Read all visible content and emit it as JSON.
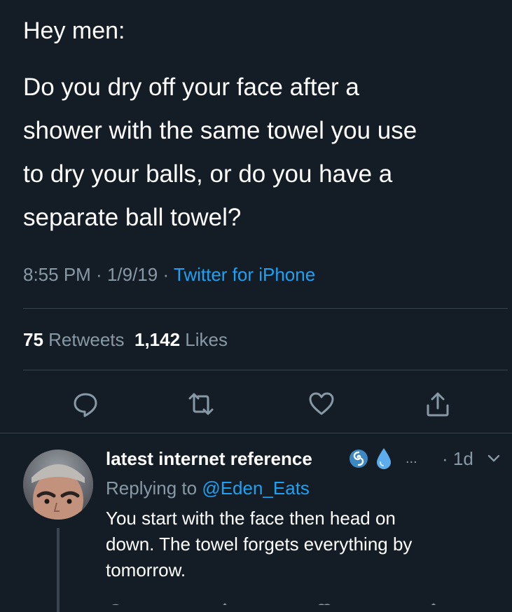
{
  "tweet": {
    "greeting": "Hey men:",
    "body_lines": [
      "Do you dry off your face after a",
      "shower with the same towel you use",
      "to dry your balls, or do you have a",
      "separate ball towel?"
    ],
    "time": "8:55 PM",
    "sep1": " · ",
    "date": "1/9/19",
    "sep2": " · ",
    "source": "Twitter for iPhone",
    "retweets_count": "75",
    "retweets_label": " Retweets",
    "likes_count": "1,142",
    "likes_label": " Likes",
    "accent_color": "#1da1f2",
    "background_color": "#141d26",
    "muted_color": "#8899a6"
  },
  "actions": {
    "icons": [
      "reply-icon",
      "retweet-icon",
      "like-icon",
      "share-icon"
    ]
  },
  "reply": {
    "name": "latest internet reference",
    "emojis": [
      "cyclone-emoji",
      "droplet-emoji"
    ],
    "ellipsis": "...",
    "time": "· 1d",
    "replying_prefix": "Replying to ",
    "replying_handle": "@Eden_Eats",
    "body_lines": [
      "You start with the face then head on",
      "down. The towel forgets everything by",
      "tomorrow."
    ]
  }
}
